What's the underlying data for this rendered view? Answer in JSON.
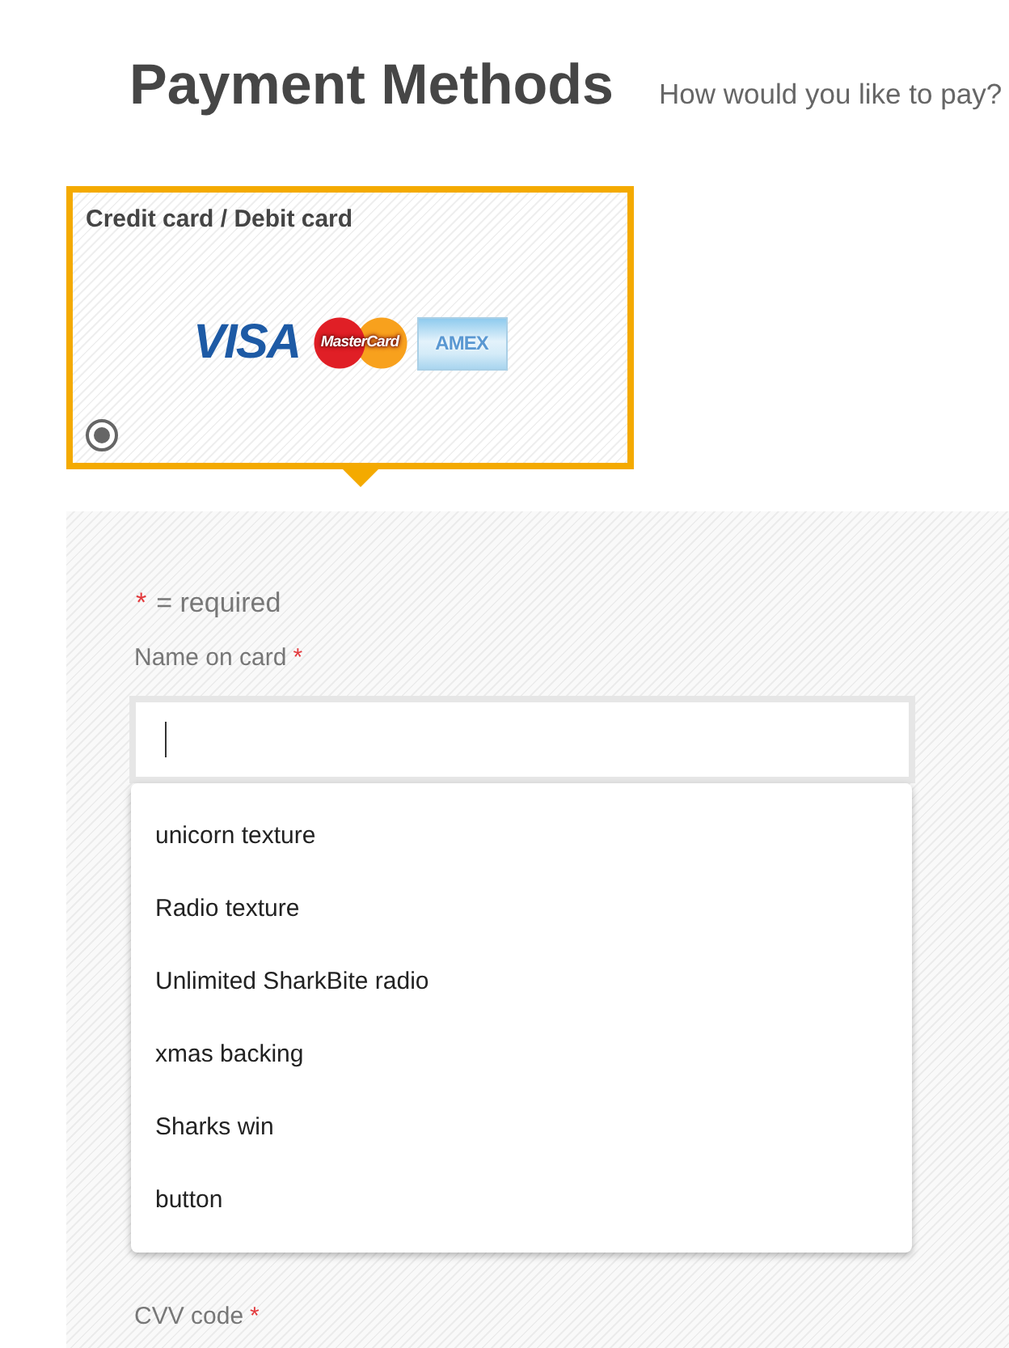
{
  "header": {
    "title": "Payment Methods",
    "subtitle": "How would you like to pay?"
  },
  "payment_methods": [
    {
      "label": "Credit card / Debit card",
      "selected": true,
      "logos": [
        {
          "kind": "visa",
          "text": "VISA"
        },
        {
          "kind": "mastercard",
          "text": "MasterCard"
        },
        {
          "kind": "amex",
          "text": "AMEX"
        }
      ]
    }
  ],
  "form": {
    "required_note": {
      "mark": "*",
      "text": "= required"
    },
    "name_field": {
      "label": "Name on card",
      "required_mark": "*",
      "focused": true
    },
    "suggestions": [
      "unicorn texture",
      "Radio texture",
      "Unlimited SharkBite radio",
      "xmas backing",
      "Sharks win",
      "button"
    ],
    "cvv_field": {
      "label": "CVV code",
      "required_mark": "*"
    }
  }
}
